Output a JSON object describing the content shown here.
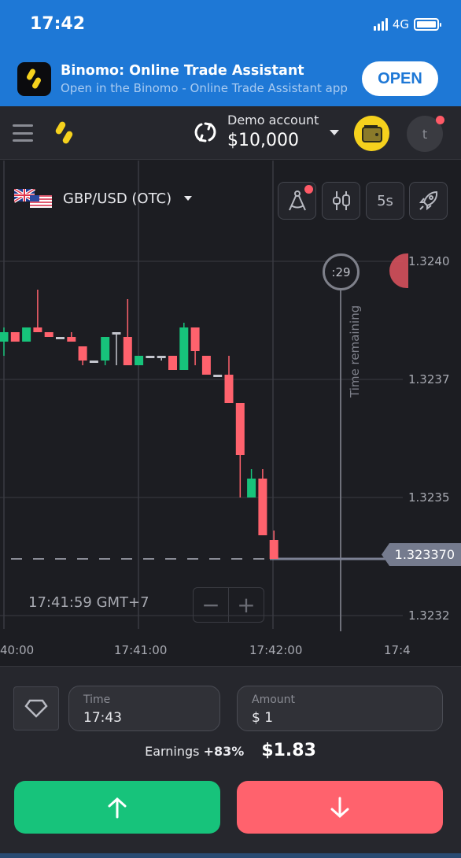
{
  "status_bar": {
    "time": "17:42",
    "network": "4G"
  },
  "app_banner": {
    "title": "Binomo: Online Trade Assistant",
    "subtitle": "Open in the Binomo - Online Trade Assistant app",
    "open_label": "OPEN"
  },
  "header": {
    "account_label": "Demo account",
    "balance": "$10,000",
    "avatar_initial": "t"
  },
  "asset": {
    "pair": "GBP/USD (OTC)"
  },
  "toolbar": {
    "timeframe": "5s"
  },
  "colors": {
    "up": "#17c37b",
    "down": "#ff626d",
    "doji": "#c4c6ce",
    "accent_yellow": "#f5d11d",
    "banner_blue": "#1e78d6"
  },
  "chart_data": {
    "type": "candlestick",
    "title": "GBP/USD (OTC)",
    "y_ticks": [
      "1.3240",
      "1.3237",
      "1.3235",
      "1.3232"
    ],
    "y_tick_values": [
      1.324,
      1.32375,
      1.3235,
      1.32325
    ],
    "x_ticks": [
      "40:00",
      "17:41:00",
      "17:42:00",
      "17:4"
    ],
    "ylim": [
      1.3231,
      1.32445
    ],
    "current_price": "1.323370",
    "current_price_value": 1.32337,
    "timer": ":29",
    "timer_label": "Time remaining",
    "clock": "17:41:59 GMT+7",
    "candles": [
      {
        "o": 1.32383,
        "c": 1.32385,
        "h": 1.32386,
        "l": 1.3238,
        "dir": "up"
      },
      {
        "o": 1.32385,
        "c": 1.32383,
        "h": 1.32385,
        "l": 1.32383,
        "dir": "down"
      },
      {
        "o": 1.32383,
        "c": 1.32386,
        "h": 1.32386,
        "l": 1.32383,
        "dir": "up"
      },
      {
        "o": 1.32386,
        "c": 1.32385,
        "h": 1.32394,
        "l": 1.32385,
        "dir": "down"
      },
      {
        "o": 1.32385,
        "c": 1.32384,
        "h": 1.32385,
        "l": 1.32384,
        "dir": "down"
      },
      {
        "o": 1.32384,
        "c": 1.32384,
        "h": 1.32384,
        "l": 1.32384,
        "dir": "doji"
      },
      {
        "o": 1.32384,
        "c": 1.32383,
        "h": 1.32385,
        "l": 1.32383,
        "dir": "down"
      },
      {
        "o": 1.32382,
        "c": 1.32379,
        "h": 1.32382,
        "l": 1.32378,
        "dir": "down"
      },
      {
        "o": 1.32379,
        "c": 1.32379,
        "h": 1.32379,
        "l": 1.32379,
        "dir": "doji"
      },
      {
        "o": 1.32379,
        "c": 1.32384,
        "h": 1.32384,
        "l": 1.32378,
        "dir": "up"
      },
      {
        "o": 1.32385,
        "c": 1.32385,
        "h": 1.32385,
        "l": 1.32378,
        "dir": "doji"
      },
      {
        "o": 1.32384,
        "c": 1.32378,
        "h": 1.32392,
        "l": 1.32378,
        "dir": "down"
      },
      {
        "o": 1.32378,
        "c": 1.3238,
        "h": 1.3238,
        "l": 1.32378,
        "dir": "up"
      },
      {
        "o": 1.3238,
        "c": 1.3238,
        "h": 1.3238,
        "l": 1.3238,
        "dir": "doji"
      },
      {
        "o": 1.3238,
        "c": 1.3238,
        "h": 1.3238,
        "l": 1.32379,
        "dir": "doji"
      },
      {
        "o": 1.3238,
        "c": 1.32377,
        "h": 1.3238,
        "l": 1.32377,
        "dir": "down"
      },
      {
        "o": 1.32377,
        "c": 1.32386,
        "h": 1.32387,
        "l": 1.32377,
        "dir": "up"
      },
      {
        "o": 1.32386,
        "c": 1.32381,
        "h": 1.32386,
        "l": 1.32378,
        "dir": "down"
      },
      {
        "o": 1.3238,
        "c": 1.32376,
        "h": 1.3238,
        "l": 1.32376,
        "dir": "down"
      },
      {
        "o": 1.32376,
        "c": 1.32376,
        "h": 1.32376,
        "l": 1.32376,
        "dir": "doji"
      },
      {
        "o": 1.32376,
        "c": 1.3237,
        "h": 1.3238,
        "l": 1.3237,
        "dir": "down"
      },
      {
        "o": 1.3237,
        "c": 1.32359,
        "h": 1.3237,
        "l": 1.3235,
        "dir": "down"
      },
      {
        "o": 1.3235,
        "c": 1.32354,
        "h": 1.32356,
        "l": 1.3235,
        "dir": "up"
      },
      {
        "o": 1.32354,
        "c": 1.32342,
        "h": 1.32356,
        "l": 1.32342,
        "dir": "down"
      },
      {
        "o": 1.32341,
        "c": 1.32337,
        "h": 1.32343,
        "l": 1.32337,
        "dir": "down"
      }
    ]
  },
  "trade_panel": {
    "time_label": "Time",
    "time_value": "17:43",
    "amount_label": "Amount",
    "amount_value": "$ 1",
    "earnings_label": "Earnings",
    "earnings_pct": "+83%",
    "earnings_amount": "$1.83"
  }
}
